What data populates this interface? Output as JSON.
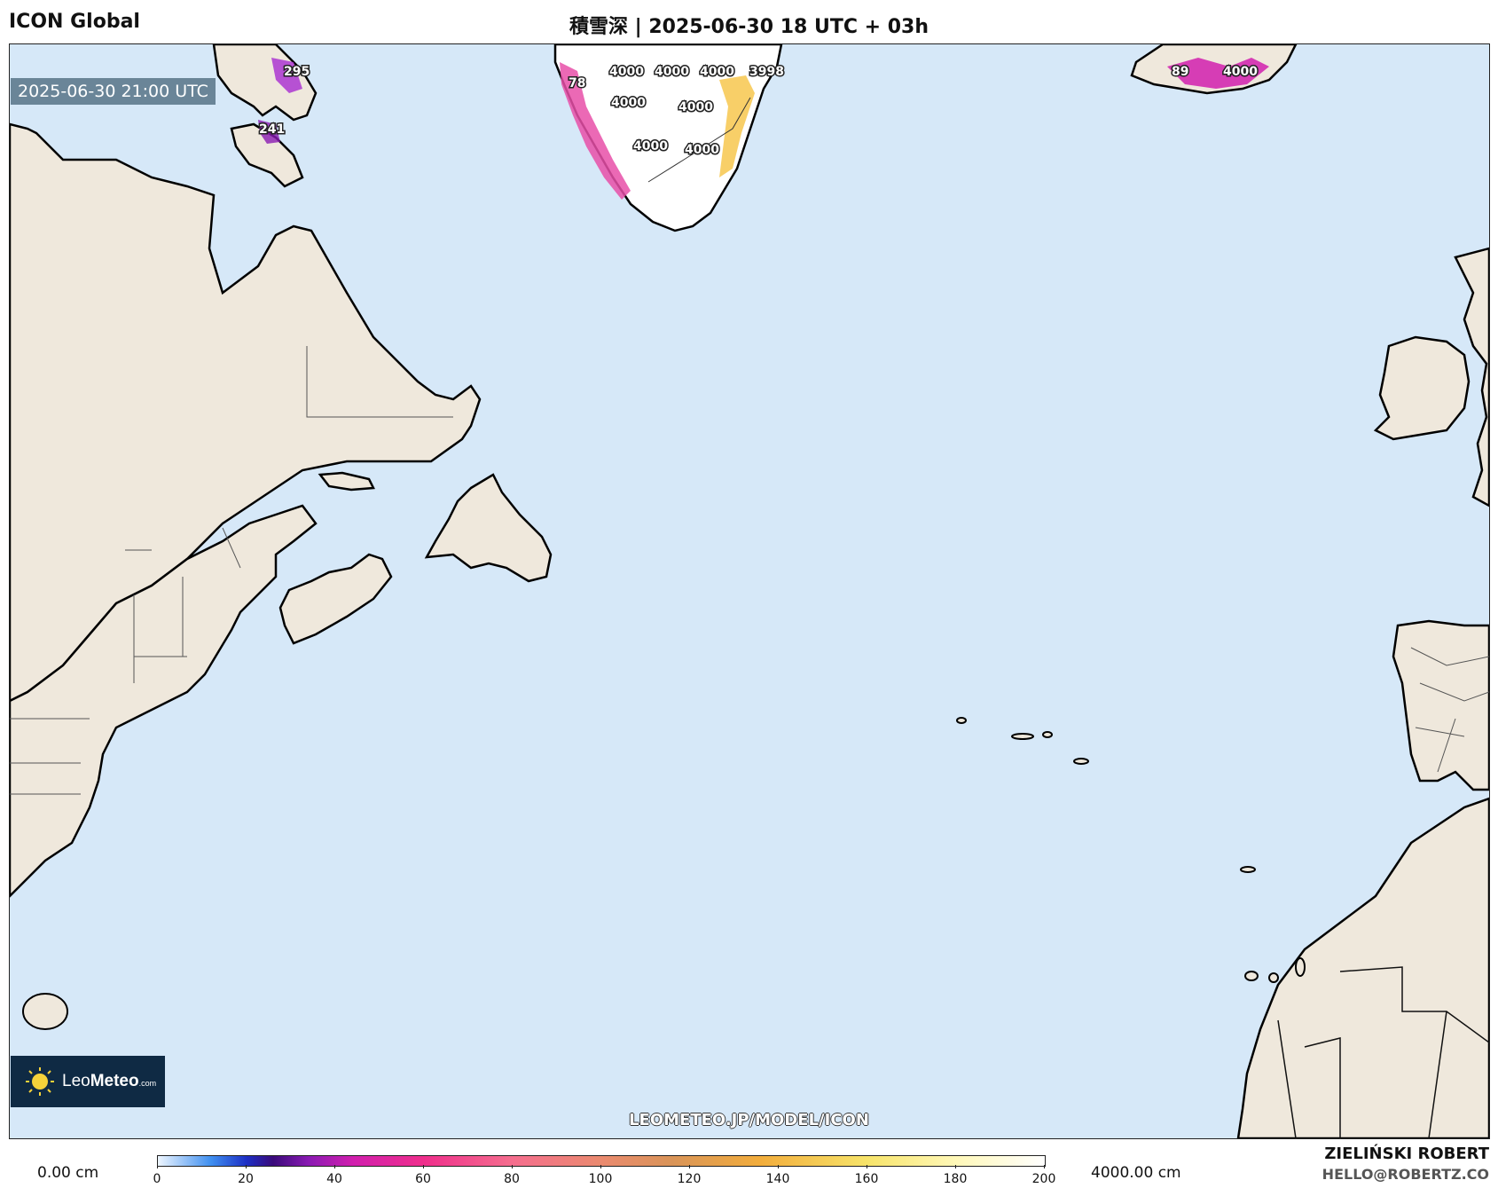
{
  "header": {
    "model": "ICON Global",
    "title": "積雪深 | 2025-06-30 18 UTC + 03h"
  },
  "valid_time": "2025-06-30 21:00 UTC",
  "logo": {
    "brand_light": "Leo",
    "brand_bold": "Meteo",
    "suffix": ".com"
  },
  "source_url": "LEOMETEO.JP/MODEL/ICON",
  "colorbar": {
    "min_label": "0.00 cm",
    "max_label": "4000.00 cm",
    "ticks": [
      "0",
      "20",
      "40",
      "60",
      "80",
      "100",
      "120",
      "140",
      "160",
      "180",
      "200"
    ]
  },
  "author": {
    "name": "ZIELIŃSKI ROBERT",
    "email": "HELLO@ROBERTZ.CO"
  },
  "map_labels": [
    {
      "id": "ellesmere-1",
      "text": "295"
    },
    {
      "id": "ellesmere-2",
      "text": "241"
    },
    {
      "id": "greenland-1",
      "text": "78"
    },
    {
      "id": "greenland-2",
      "text": "4000"
    },
    {
      "id": "greenland-3",
      "text": "4000"
    },
    {
      "id": "greenland-4",
      "text": "4000"
    },
    {
      "id": "greenland-5",
      "text": "3998"
    },
    {
      "id": "greenland-6",
      "text": "4000"
    },
    {
      "id": "greenland-7",
      "text": "4000"
    },
    {
      "id": "greenland-8",
      "text": "4000"
    },
    {
      "id": "greenland-9",
      "text": "4000"
    },
    {
      "id": "iceland-1",
      "text": "89"
    },
    {
      "id": "iceland-2",
      "text": "4000"
    }
  ],
  "colors": {
    "ocean": "#d6e8f8",
    "land": "#efe8dc",
    "coast": "#000000"
  }
}
